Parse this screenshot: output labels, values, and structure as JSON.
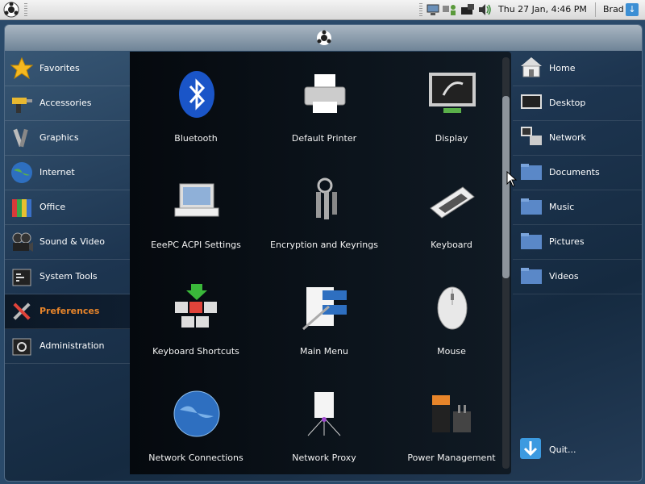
{
  "panel": {
    "clock": "Thu 27 Jan,  4:46 PM",
    "user": "Brad"
  },
  "categories": [
    {
      "label": "Favorites",
      "icon": "star-icon"
    },
    {
      "label": "Accessories",
      "icon": "drill-icon"
    },
    {
      "label": "Graphics",
      "icon": "brushes-icon"
    },
    {
      "label": "Internet",
      "icon": "globe-icon"
    },
    {
      "label": "Office",
      "icon": "books-icon"
    },
    {
      "label": "Sound & Video",
      "icon": "film-camera-icon"
    },
    {
      "label": "System Tools",
      "icon": "tools-icon"
    },
    {
      "label": "Preferences",
      "icon": "wrench-screwdriver-icon",
      "active": true
    },
    {
      "label": "Administration",
      "icon": "admin-icon"
    }
  ],
  "apps": [
    {
      "label": "Bluetooth",
      "icon": "bluetooth-icon"
    },
    {
      "label": "Default Printer",
      "icon": "printer-icon"
    },
    {
      "label": "Display",
      "icon": "monitor-icon"
    },
    {
      "label": "EeePC ACPI Settings",
      "icon": "laptop-icon"
    },
    {
      "label": "Encryption and Keyrings",
      "icon": "keys-icon"
    },
    {
      "label": "Keyboard",
      "icon": "keyboard-icon"
    },
    {
      "label": "Keyboard Shortcuts",
      "icon": "keyboard-shortcuts-icon"
    },
    {
      "label": "Main Menu",
      "icon": "menu-editor-icon"
    },
    {
      "label": "Mouse",
      "icon": "mouse-icon"
    },
    {
      "label": "Network Connections",
      "icon": "network-globe-icon"
    },
    {
      "label": "Network Proxy",
      "icon": "proxy-icon"
    },
    {
      "label": "Power Management",
      "icon": "battery-icon"
    }
  ],
  "places": [
    {
      "label": "Home",
      "icon": "home-icon"
    },
    {
      "label": "Desktop",
      "icon": "desktop-icon"
    },
    {
      "label": "Network",
      "icon": "network-icon"
    },
    {
      "label": "Documents",
      "icon": "folder-icon"
    },
    {
      "label": "Music",
      "icon": "folder-icon"
    },
    {
      "label": "Pictures",
      "icon": "folder-icon"
    },
    {
      "label": "Videos",
      "icon": "folder-icon"
    }
  ],
  "quit": {
    "label": "Quit...",
    "icon": "quit-arrow-icon"
  },
  "colors": {
    "active_label": "#e8852a",
    "window_bg": "#1d3550",
    "panel_bg": "#e6e6e6"
  }
}
